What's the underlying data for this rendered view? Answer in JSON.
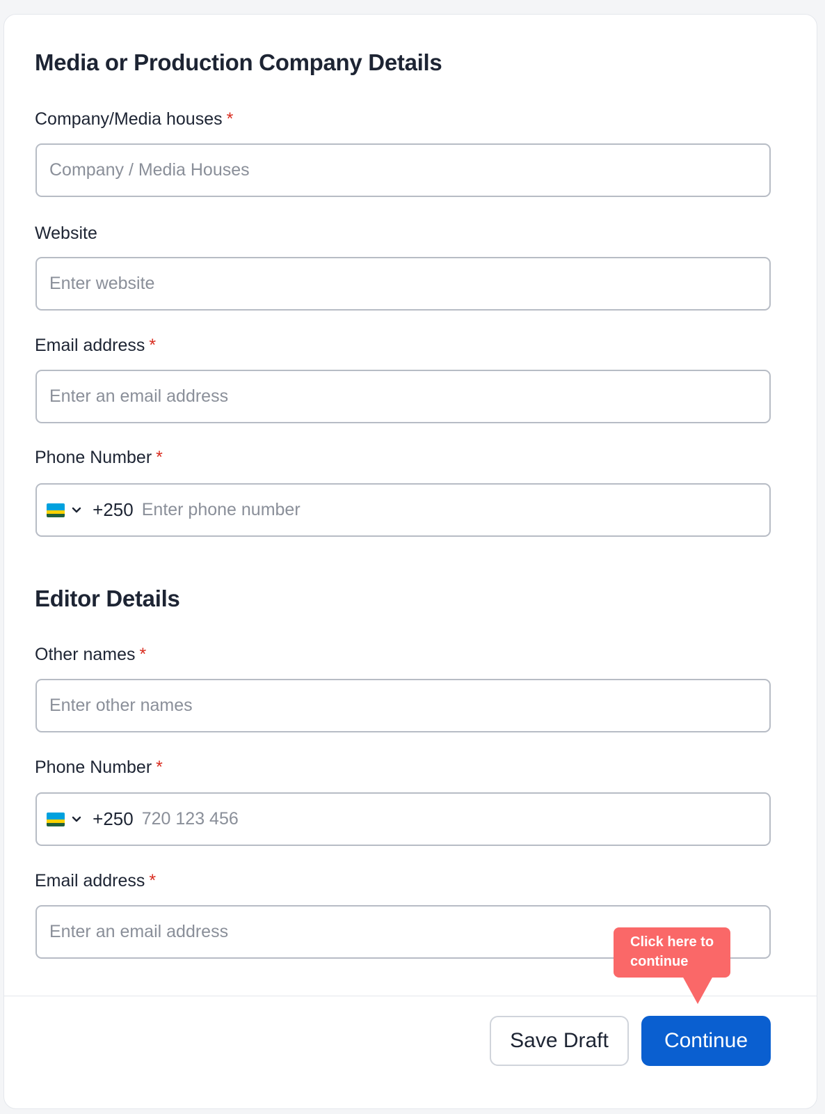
{
  "company_section": {
    "title": "Media or Production Company Details",
    "company_label": "Company/Media houses",
    "company_placeholder": "Company / Media Houses",
    "website_label": "Website",
    "website_placeholder": "Enter website",
    "email_label": "Email address",
    "email_placeholder": "Enter an email address",
    "phone_label": "Phone Number",
    "phone_dial_code": "+250",
    "phone_placeholder": "Enter phone number"
  },
  "editor_section": {
    "title": "Editor Details",
    "other_names_label": "Other names",
    "other_names_placeholder": "Enter other names",
    "phone_label": "Phone Number",
    "phone_dial_code": "+250",
    "phone_placeholder": "720 123 456",
    "email_label": "Email address",
    "email_placeholder": "Enter an email address"
  },
  "required_marker": "*",
  "footer": {
    "save_draft_label": "Save Draft",
    "continue_label": "Continue"
  },
  "tooltip": {
    "text_line1": "Click here to",
    "text_line2": "continue"
  },
  "colors": {
    "primary": "#0a5fd0",
    "tooltip": "#fa6868",
    "required": "#d92d20"
  },
  "icons": {
    "flag": "rwanda-flag-icon",
    "dropdown": "chevron-down-icon"
  }
}
